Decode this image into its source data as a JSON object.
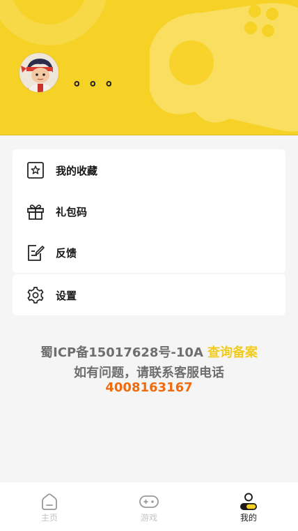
{
  "profile": {
    "username": "。。。"
  },
  "menu": {
    "favorites": "我的收藏",
    "gift_code": "礼包码",
    "feedback": "反馈",
    "settings": "设置"
  },
  "footer": {
    "icp": "蜀ICP备15017628号-10A",
    "icp_query": "查询备案",
    "help": "如有问题，请联系客服电话",
    "phone": "4008163167"
  },
  "tabbar": {
    "home": "主页",
    "games": "游戏",
    "mine": "我的"
  },
  "colors": {
    "brand_yellow": "#f6d227",
    "link_yellow": "#f1cc1e",
    "phone_orange": "#ef6b0f"
  }
}
